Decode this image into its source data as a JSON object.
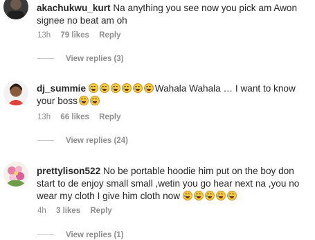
{
  "comments": [
    {
      "username": "akachukwu_kurt",
      "text": "Na anything you see now you pick am Awon signee no beat am oh",
      "time": "13h",
      "likes": "79 likes",
      "reply": "Reply",
      "view_replies": "View replies (3)"
    },
    {
      "username": "dj_summie",
      "text_after": "Wahala Wahala … I want to know your boss",
      "time": "13h",
      "likes": "66 likes",
      "reply": "Reply",
      "view_replies": "View replies (24)"
    },
    {
      "username": "prettylison522",
      "text": "No be portable hoodie him put on the boy don start to de enjoy small small ,wetin you go hear next na ,you no wear my cloth I give him cloth now",
      "time": "4h",
      "likes": "3 likes",
      "reply": "Reply",
      "view_replies": "View replies (1)"
    }
  ],
  "emoji_icon": "face-with-tears-of-joy-icon",
  "colors": {
    "text": "#262626",
    "meta": "#8e8e8e",
    "divider": "#c7c7c7",
    "emoji": "#f7c948"
  }
}
